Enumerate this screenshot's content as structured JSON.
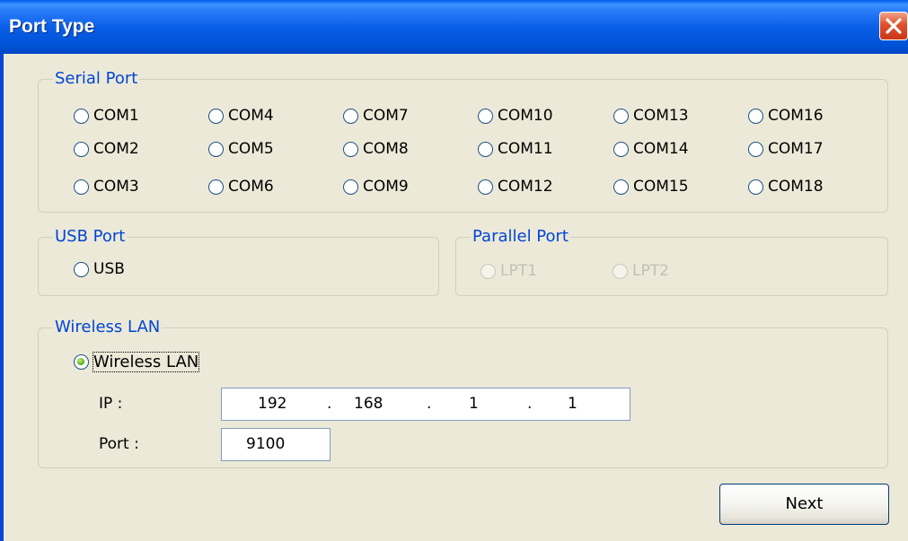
{
  "window": {
    "title": "Port Type"
  },
  "serial": {
    "title": "Serial Port",
    "ports": [
      "COM1",
      "COM2",
      "COM3",
      "COM4",
      "COM5",
      "COM6",
      "COM7",
      "COM8",
      "COM9",
      "COM10",
      "COM11",
      "COM12",
      "COM13",
      "COM14",
      "COM15",
      "COM16",
      "COM17",
      "COM18"
    ]
  },
  "usb": {
    "title": "USB Port",
    "label": "USB"
  },
  "parallel": {
    "title": "Parallel Port",
    "ports": [
      "LPT1",
      "LPT2"
    ]
  },
  "wireless": {
    "title": "Wireless LAN",
    "option_label": "Wireless LAN",
    "selected": true,
    "ip_label": "IP :",
    "ip": [
      "192",
      "168",
      "1",
      "1"
    ],
    "ip_dot": ".",
    "port_label": "Port :",
    "port": "9100"
  },
  "buttons": {
    "next": "Next"
  },
  "colors": {
    "titlebar": "#0a5fe8",
    "group_title": "#0046d5",
    "close": "#e0502c"
  }
}
